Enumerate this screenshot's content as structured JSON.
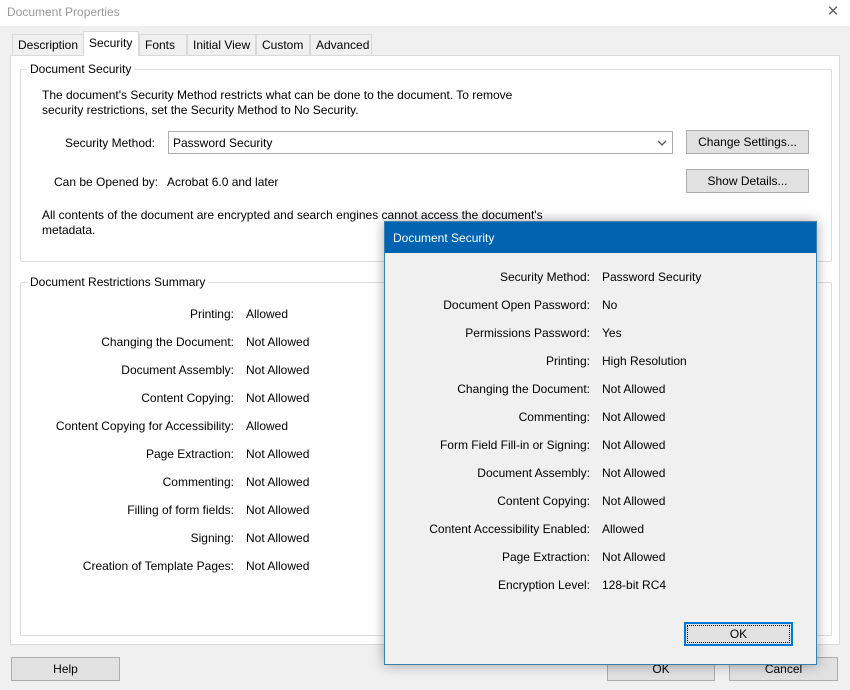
{
  "window": {
    "title": "Document Properties"
  },
  "tabs": [
    "Description",
    "Security",
    "Fonts",
    "Initial View",
    "Custom",
    "Advanced"
  ],
  "doc_security": {
    "legend": "Document Security",
    "desc_line1": "The document's Security Method restricts what can be done to the document. To remove",
    "desc_line2": "security restrictions, set the Security Method to No Security.",
    "method_label": "Security Method:",
    "method_value": "Password Security",
    "change_settings": "Change Settings...",
    "opened_label": "Can be Opened by:",
    "opened_value": "Acrobat 6.0 and later",
    "show_details": "Show Details...",
    "note_line1": "All contents of the document are encrypted and search engines cannot access the document's",
    "note_line2": "metadata."
  },
  "restrictions": {
    "legend": "Document Restrictions Summary",
    "rows": [
      {
        "label": "Printing:",
        "value": "Allowed"
      },
      {
        "label": "Changing the Document:",
        "value": "Not Allowed"
      },
      {
        "label": "Document Assembly:",
        "value": "Not Allowed"
      },
      {
        "label": "Content Copying:",
        "value": "Not Allowed"
      },
      {
        "label": "Content Copying for Accessibility:",
        "value": "Allowed"
      },
      {
        "label": "Page Extraction:",
        "value": "Not Allowed"
      },
      {
        "label": "Commenting:",
        "value": "Not Allowed"
      },
      {
        "label": "Filling of form fields:",
        "value": "Not Allowed"
      },
      {
        "label": "Signing:",
        "value": "Not Allowed"
      },
      {
        "label": "Creation of Template Pages:",
        "value": "Not Allowed"
      }
    ]
  },
  "footer": {
    "help": "Help",
    "ok": "OK",
    "cancel": "Cancel"
  },
  "popup": {
    "title": "Document Security",
    "rows": [
      {
        "label": "Security Method:",
        "value": "Password Security"
      },
      {
        "label": "Document Open Password:",
        "value": "No"
      },
      {
        "label": "Permissions Password:",
        "value": "Yes"
      },
      {
        "label": "Printing:",
        "value": "High Resolution"
      },
      {
        "label": "Changing the Document:",
        "value": "Not Allowed"
      },
      {
        "label": "Commenting:",
        "value": "Not Allowed"
      },
      {
        "label": "Form Field Fill-in or Signing:",
        "value": "Not Allowed"
      },
      {
        "label": "Document Assembly:",
        "value": "Not Allowed"
      },
      {
        "label": "Content Copying:",
        "value": "Not Allowed"
      },
      {
        "label": "Content Accessibility Enabled:",
        "value": "Allowed"
      },
      {
        "label": "Page Extraction:",
        "value": "Not Allowed"
      },
      {
        "label": "Encryption Level:",
        "value": "128-bit RC4"
      }
    ],
    "ok": "OK"
  },
  "icons": {
    "close": "close-icon",
    "dropdown": "chevron-down-icon"
  },
  "colors": {
    "accent": "#0063b1",
    "focus": "#0078d7"
  }
}
